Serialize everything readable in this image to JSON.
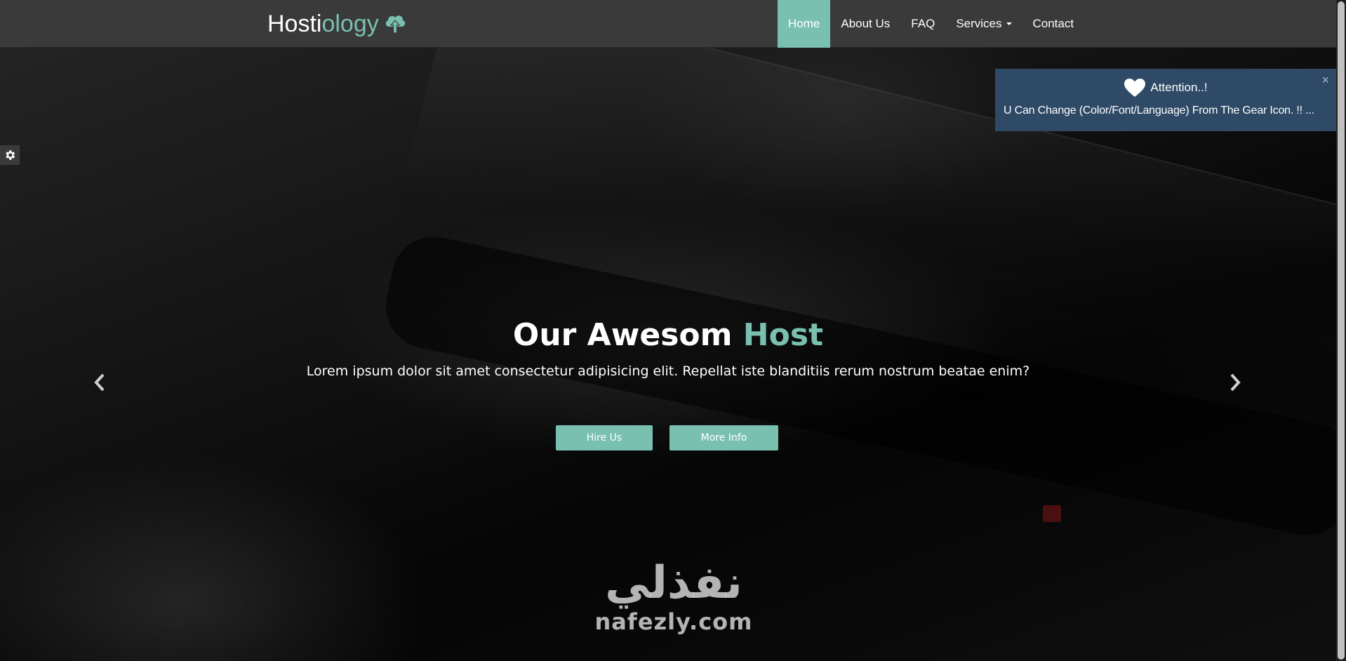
{
  "brand": {
    "part1": "Hosti",
    "part2": "ology",
    "icon": "cloud-upload-icon"
  },
  "nav": {
    "items": [
      {
        "label": "Home",
        "active": true
      },
      {
        "label": "About Us"
      },
      {
        "label": "FAQ"
      },
      {
        "label": "Services",
        "dropdown": true
      },
      {
        "label": "Contact"
      }
    ]
  },
  "notice": {
    "title": "Attention..!",
    "body": "U Can Change (Color/Font/Language) From The Gear Icon. !! ...",
    "close": "×",
    "icon": "heart-icon"
  },
  "settings": {
    "icon": "gear-icon"
  },
  "hero": {
    "title_part1": "Our Awesom ",
    "title_part2": "Host",
    "subtitle": "Lorem ipsum dolor sit amet consectetur adipisicing elit. Repellat iste blanditiis rerum nostrum beatae enim?",
    "primary_button": "Hire Us",
    "secondary_button": "More Info",
    "prev_icon": "chevron-left-icon",
    "next_icon": "chevron-right-icon"
  },
  "watermark": {
    "arabic": "نفذلي",
    "latin": "nafezly.com"
  },
  "colors": {
    "accent": "#7ac0b0",
    "navbar": "#3a3a3a",
    "notice_bg": "#2e4a66"
  }
}
